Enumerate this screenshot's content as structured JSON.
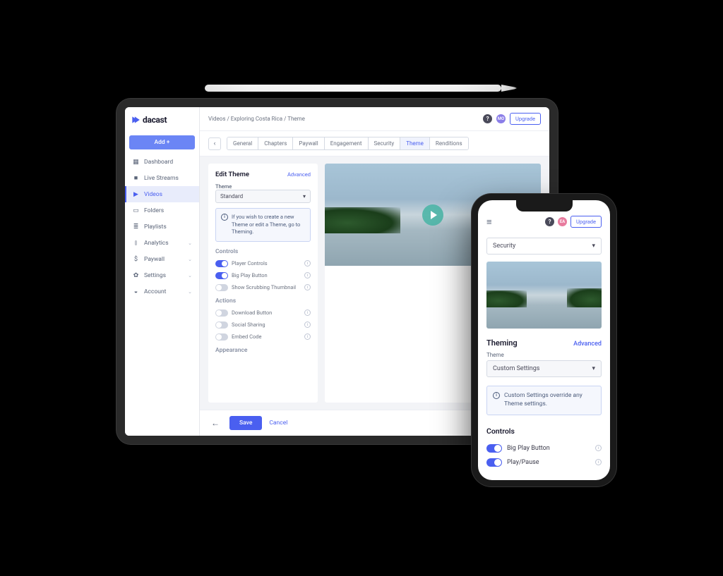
{
  "brand": {
    "name": "dacast"
  },
  "sidebar": {
    "add_label": "Add +",
    "items": [
      {
        "label": "Dashboard"
      },
      {
        "label": "Live Streams"
      },
      {
        "label": "Videos"
      },
      {
        "label": "Folders"
      },
      {
        "label": "Playlists"
      },
      {
        "label": "Analytics"
      },
      {
        "label": "Paywall"
      },
      {
        "label": "Settings"
      },
      {
        "label": "Account"
      }
    ]
  },
  "breadcrumb": "Videos / Exploring Costa Rica / Theme",
  "topbar": {
    "upgrade": "Upgrade",
    "avatar_initials": "MO"
  },
  "tabs": [
    "General",
    "Chapters",
    "Paywall",
    "Engagement",
    "Security",
    "Theme",
    "Renditions"
  ],
  "edit": {
    "title": "Edit Theme",
    "advanced": "Advanced",
    "theme_label": "Theme",
    "theme_value": "Standard",
    "info": "If you wish to create a new Theme or edit a Theme, go to Theming.",
    "controls_head": "Controls",
    "controls": [
      {
        "label": "Player Controls",
        "on": true
      },
      {
        "label": "Big Play Button",
        "on": true
      },
      {
        "label": "Show Scrubbing Thumbnail",
        "on": false
      }
    ],
    "actions_head": "Actions",
    "actions": [
      {
        "label": "Download Button",
        "on": false
      },
      {
        "label": "Social Sharing",
        "on": false
      },
      {
        "label": "Embed Code",
        "on": false
      }
    ],
    "appearance_head": "Appearance"
  },
  "footer": {
    "save": "Save",
    "cancel": "Cancel"
  },
  "phone": {
    "upgrade": "Upgrade",
    "avatar_initials": "EA",
    "select_value": "Security",
    "theming_title": "Theming",
    "advanced": "Advanced",
    "theme_label": "Theme",
    "theme_value": "Custom Settings",
    "info": "Custom Settings override any Theme settings.",
    "controls_title": "Controls",
    "controls": [
      {
        "label": "Big Play Button",
        "on": true
      },
      {
        "label": "Play/Pause",
        "on": true
      }
    ]
  }
}
